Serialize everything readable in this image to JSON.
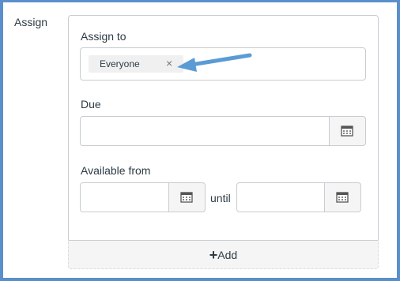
{
  "section": {
    "label": "Assign"
  },
  "assign_to": {
    "label": "Assign to",
    "tokens": [
      {
        "text": "Everyone",
        "remove_symbol": "×"
      }
    ]
  },
  "due": {
    "label": "Due",
    "value": "",
    "calendar_icon": "calendar-icon"
  },
  "available_from": {
    "label": "Available from",
    "value": "",
    "calendar_icon": "calendar-icon"
  },
  "until": {
    "label": "until",
    "value": "",
    "calendar_icon": "calendar-icon"
  },
  "add": {
    "plus": "+",
    "label": "Add"
  },
  "annotation": {
    "arrow_icon": "arrow-icon",
    "color": "#5b9bd5"
  },
  "colors": {
    "frame": "#5a8fcc",
    "border": "#c7cdd1",
    "text": "#2d3b45"
  }
}
